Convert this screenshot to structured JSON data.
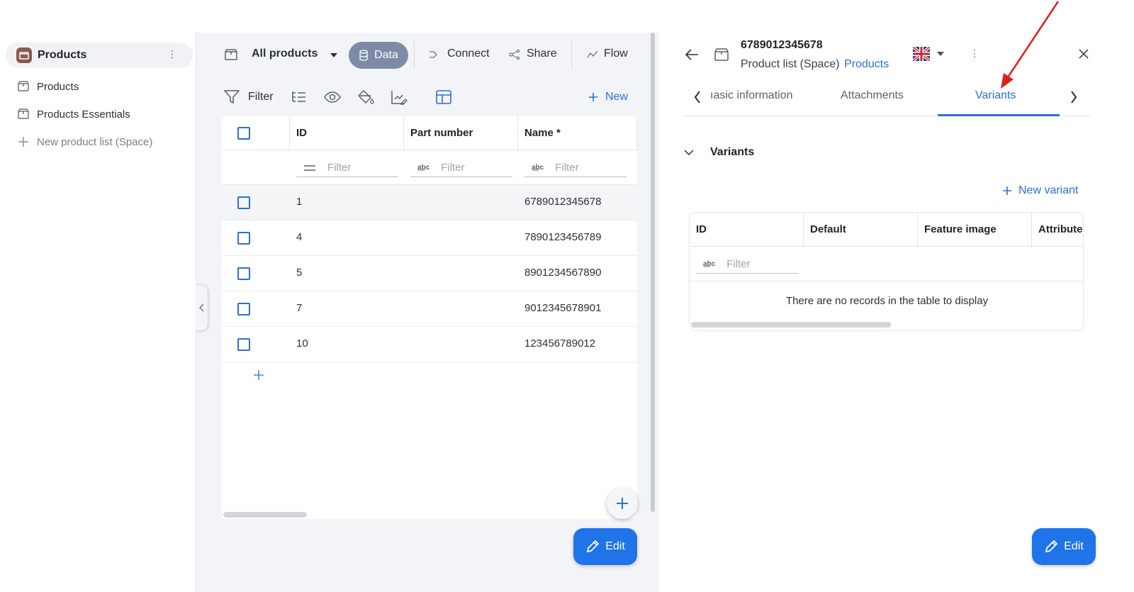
{
  "sidebar": {
    "title": "Products",
    "items": [
      {
        "label": "Products"
      },
      {
        "label": "Products Essentials"
      },
      {
        "label": "New product list (Space)"
      }
    ]
  },
  "toolbar": {
    "view_name": "All products",
    "data_label": "Data",
    "connect_label": "Connect",
    "share_label": "Share",
    "flow_label": "Flow",
    "filter_label": "Filter",
    "new_label": "New"
  },
  "grid": {
    "columns": [
      "ID",
      "Part number",
      "Name *"
    ],
    "filter_placeholder": "Filter",
    "rows": [
      {
        "id": "1",
        "part_number": "",
        "name": "6789012345678"
      },
      {
        "id": "4",
        "part_number": "",
        "name": "7890123456789"
      },
      {
        "id": "5",
        "part_number": "",
        "name": "8901234567890"
      },
      {
        "id": "7",
        "part_number": "",
        "name": "9012345678901"
      },
      {
        "id": "10",
        "part_number": "",
        "name": "123456789012"
      }
    ]
  },
  "edit_label": "Edit",
  "detail": {
    "title": "6789012345678",
    "subtitle": "Product list (Space)",
    "subtitle_link": "Products",
    "tabs": [
      {
        "label": "ıasic information"
      },
      {
        "label": "Attachments"
      },
      {
        "label": "Variants",
        "active": true
      }
    ],
    "section_title": "Variants",
    "new_variant_label": "New variant",
    "variant_columns": [
      "ID",
      "Default",
      "Feature image",
      "Attribute"
    ],
    "filter_placeholder": "Filter",
    "empty_message": "There are no records in the table to display",
    "edit_label": "Edit"
  },
  "colors": {
    "accent": "#2b6fd6",
    "edit_button": "#1f74e8",
    "data_pill": "#7d8ba6",
    "annotation_arrow": "#e0201f"
  }
}
